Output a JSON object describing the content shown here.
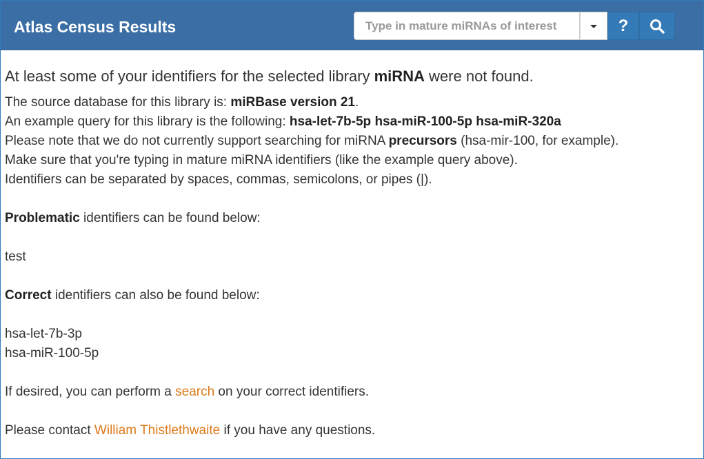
{
  "header": {
    "title": "Atlas Census Results",
    "search_placeholder": "Type in mature miRNAs of interest",
    "help_label": "?"
  },
  "icons": {
    "dropdown": "chevron-down-icon",
    "help": "question-icon",
    "search": "search-icon"
  },
  "colors": {
    "header_bg": "#3a6ea5",
    "button_bg": "#337ab7",
    "link": "#dd7a1a"
  },
  "content": {
    "lead_prefix": "At least some of your identifiers for the selected library ",
    "lead_library": "miRNA",
    "lead_suffix": " were not found.",
    "source_prefix": "The source database for this library is: ",
    "source_value": "miRBase version 21",
    "source_suffix": ".",
    "example_prefix": "An example query for this library is the following: ",
    "example_value": "hsa-let-7b-5p hsa-miR-100-5p hsa-miR-320a",
    "precursor_prefix": "Please note that we do not currently support searching for miRNA ",
    "precursor_bold": "precursors",
    "precursor_suffix": " (hsa-mir-100, for example).",
    "mature_note": "Make sure that you're typing in mature miRNA identifiers (like the example query above).",
    "separator_note": "Identifiers can be separated by spaces, commas, semicolons, or pipes (|).",
    "problematic_bold": "Problematic",
    "problematic_suffix": " identifiers can be found below:",
    "problematic_ids": [
      "test"
    ],
    "correct_bold": "Correct",
    "correct_suffix": " identifiers can also be found below:",
    "correct_ids": [
      "hsa-let-7b-3p",
      "hsa-miR-100-5p"
    ],
    "search_prefix": "If desired, you can perform a ",
    "search_link": "search",
    "search_suffix": " on your correct identifiers.",
    "contact_prefix": "Please contact ",
    "contact_link": "William Thistlethwaite",
    "contact_suffix": " if you have any questions."
  }
}
